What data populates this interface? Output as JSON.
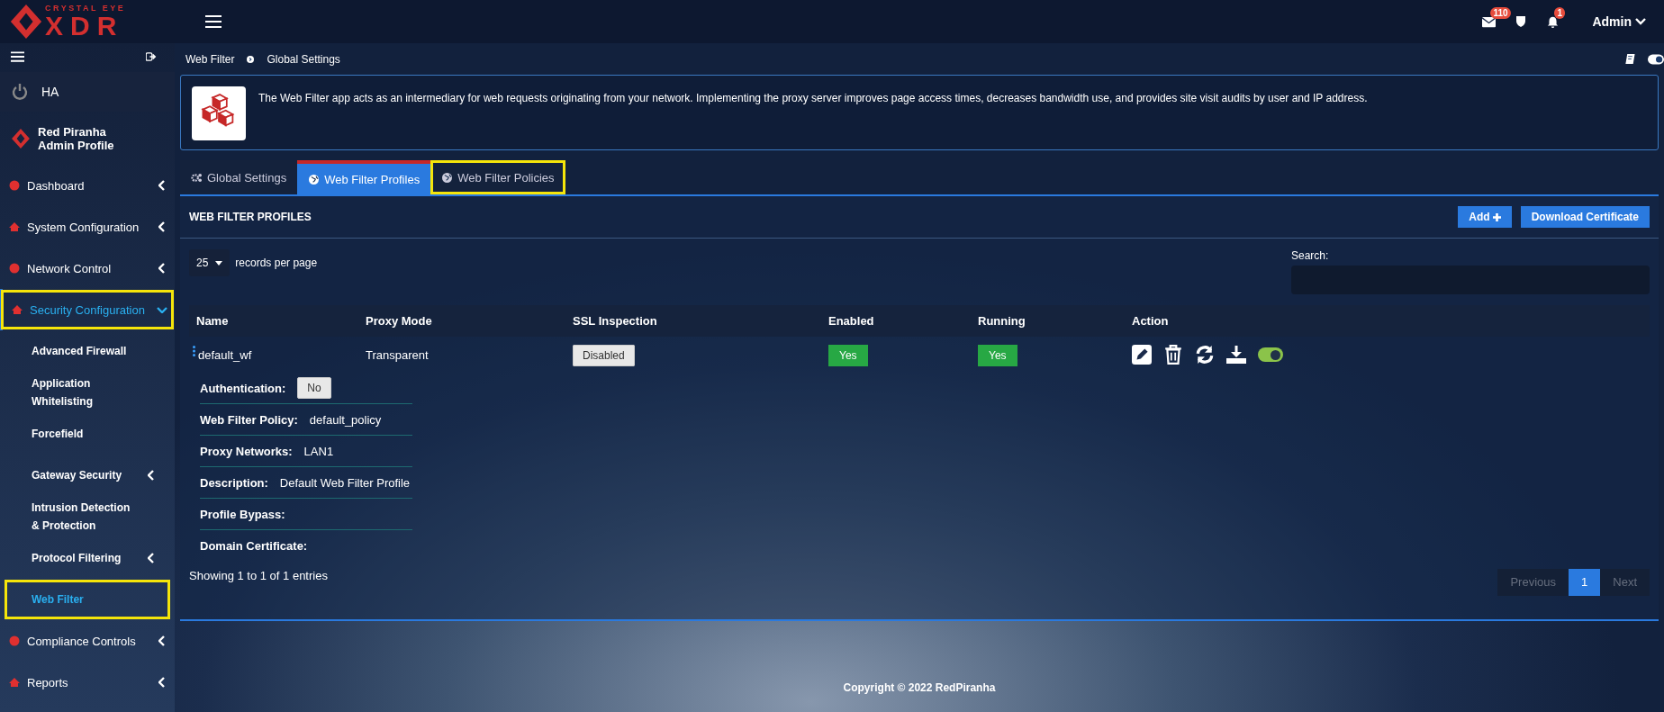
{
  "logo": {
    "tagline": "CRYSTAL EYE",
    "name": "XDR"
  },
  "header": {
    "messages_badge": "110",
    "alerts_badge": "1",
    "user": "Admin"
  },
  "sidebar": {
    "ha_label": "HA",
    "profile": {
      "name": "Red Piranha",
      "role": "Admin Profile"
    },
    "items": [
      {
        "label": "Dashboard",
        "expanded": false,
        "selected": false,
        "highlighted": false
      },
      {
        "label": "System Configuration",
        "expanded": false,
        "selected": false,
        "highlighted": false
      },
      {
        "label": "Network Control",
        "expanded": false,
        "selected": false,
        "highlighted": false
      },
      {
        "label": "Security Configuration",
        "expanded": true,
        "selected": true,
        "highlighted": true,
        "children": [
          {
            "label": "Advanced Firewall",
            "selected": false,
            "highlighted": false
          },
          {
            "label": "Application Whitelisting",
            "selected": false,
            "highlighted": false
          },
          {
            "label": "Forcefield",
            "selected": false,
            "highlighted": false
          },
          {
            "label": "Gateway Security",
            "expanded": false,
            "selected": false,
            "highlighted": false
          },
          {
            "label": "Intrusion Detection & Protection",
            "selected": false,
            "highlighted": false
          },
          {
            "label": "Protocol Filtering",
            "expanded": false,
            "selected": false,
            "highlighted": false
          },
          {
            "label": "Web Filter",
            "selected": true,
            "highlighted": true
          }
        ]
      },
      {
        "label": "Compliance Controls",
        "expanded": false,
        "selected": false,
        "highlighted": false
      },
      {
        "label": "Reports",
        "expanded": false,
        "selected": false,
        "highlighted": false
      }
    ]
  },
  "breadcrumb": [
    "Web Filter",
    "Global Settings"
  ],
  "info": {
    "text": "The Web Filter app acts as an intermediary for web requests originating from your network. Implementing the proxy server improves page access times, decreases bandwidth use, and provides site visit audits by user and IP address."
  },
  "tabs": [
    {
      "label": "Global Settings",
      "selected": false,
      "highlighted": false
    },
    {
      "label": "Web Filter Profiles",
      "selected": true,
      "highlighted": false
    },
    {
      "label": "Web Filter Policies",
      "selected": false,
      "highlighted": true
    }
  ],
  "panel": {
    "title": "WEB FILTER PROFILES",
    "buttons": [
      {
        "label": "Add",
        "kind": "add"
      },
      {
        "label": "Download Certificate",
        "kind": "plain"
      }
    ],
    "page_length": "25",
    "page_length_label": "records per page",
    "search_label": "Search:",
    "table": {
      "columns": [
        "Name",
        "Proxy Mode",
        "SSL Inspection",
        "Enabled",
        "Running",
        "Action"
      ],
      "rows": [
        {
          "name": "default_wf",
          "proxy_mode": "Transparent",
          "ssl_inspection": "Disabled",
          "enabled": "Yes",
          "running": "Yes",
          "toggle_on": true,
          "details": [
            {
              "label": "Authentication:",
              "value": "No",
              "kind": "badge"
            },
            {
              "label": "Web Filter Policy:",
              "value": "default_policy",
              "kind": "text"
            },
            {
              "label": "Proxy Networks:",
              "value": "LAN1",
              "kind": "text"
            },
            {
              "label": "Description:",
              "value": "Default Web Filter Profile",
              "kind": "text"
            },
            {
              "label": "Profile Bypass:"
            },
            {
              "label": "Domain Certificate:"
            }
          ]
        }
      ]
    },
    "summary": "Showing 1 to 1 of 1 entries",
    "pagination": [
      {
        "label": "Previous",
        "selected": false,
        "disabled": true
      },
      {
        "label": "1",
        "selected": true,
        "disabled": false
      },
      {
        "label": "Next",
        "selected": false,
        "disabled": true
      }
    ]
  },
  "footer": "Copyright © 2022 RedPiranha"
}
